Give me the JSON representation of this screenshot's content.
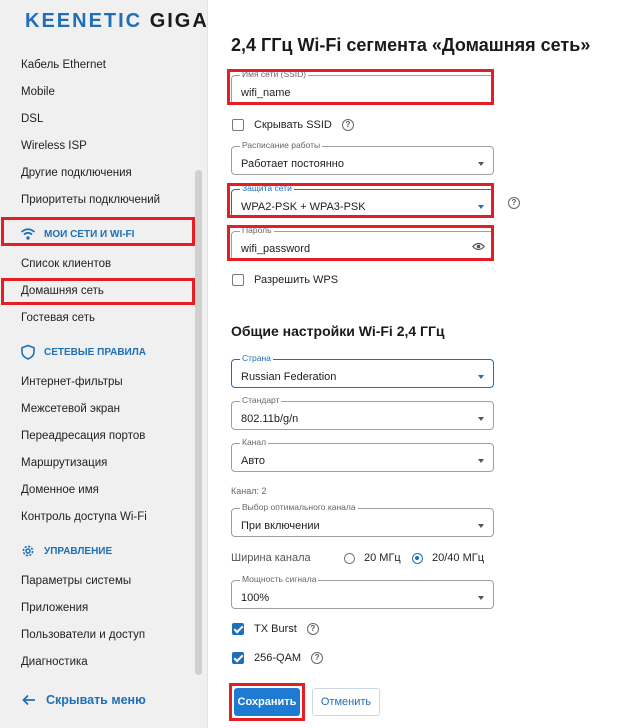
{
  "logo": {
    "text_main": "KEENETIC",
    "text_model": "GIGA"
  },
  "sidebar": {
    "items_top": [
      {
        "label": "Кабель Ethernet"
      },
      {
        "label": "Mobile"
      },
      {
        "label": "DSL"
      },
      {
        "label": "Wireless ISP"
      },
      {
        "label": "Другие подключения"
      },
      {
        "label": "Приоритеты подключений"
      }
    ],
    "section_wifi": {
      "label": "МОИ СЕТИ И WI-FI",
      "icon": "wifi-icon"
    },
    "items_wifi": [
      {
        "label": "Список клиентов"
      },
      {
        "label": "Домашняя сеть"
      },
      {
        "label": "Гостевая сеть"
      }
    ],
    "section_rules": {
      "label": "СЕТЕВЫЕ ПРАВИЛА",
      "icon": "shield-icon"
    },
    "items_rules": [
      {
        "label": "Интернет-фильтры"
      },
      {
        "label": "Межсетевой экран"
      },
      {
        "label": "Переадресация портов"
      },
      {
        "label": "Маршрутизация"
      },
      {
        "label": "Доменное имя"
      },
      {
        "label": "Контроль доступа Wi-Fi"
      }
    ],
    "section_manage": {
      "label": "УПРАВЛЕНИЕ",
      "icon": "gear-icon"
    },
    "items_manage": [
      {
        "label": "Параметры системы"
      },
      {
        "label": "Приложения"
      },
      {
        "label": "Пользователи и доступ"
      },
      {
        "label": "Диагностика"
      }
    ],
    "collapse_label": "Скрывать меню"
  },
  "main": {
    "title": "2,4 ГГц Wi-Fi сегмента «Домашняя сеть»",
    "ssid": {
      "label": "Имя сети (SSID)",
      "value": "wifi_name"
    },
    "hide_ssid": {
      "label": "Скрывать SSID",
      "checked": false
    },
    "schedule": {
      "label": "Расписание работы",
      "value": "Работает постоянно"
    },
    "security": {
      "label": "Защита сети",
      "value": "WPA2-PSK + WPA3-PSK"
    },
    "password": {
      "label": "Пароль",
      "value": "wifi_password"
    },
    "wps": {
      "label": "Разрешить WPS",
      "checked": false
    },
    "section_title": "Общие настройки Wi-Fi 2,4 ГГц",
    "country": {
      "label": "Страна",
      "value": "Russian Federation"
    },
    "standard": {
      "label": "Стандарт",
      "value": "802.11b/g/n"
    },
    "channel": {
      "label": "Канал",
      "value": "Авто"
    },
    "channel_info": "Канал: 2",
    "optimal_channel": {
      "label": "Выбор оптимального канала",
      "value": "При включении"
    },
    "channel_width": {
      "label": "Ширина канала",
      "options": [
        {
          "label": "20 МГц",
          "selected": false
        },
        {
          "label": "20/40 МГц",
          "selected": true
        }
      ]
    },
    "power": {
      "label": "Мощность сигнала",
      "value": "100%"
    },
    "tx_burst": {
      "label": "TX Burst",
      "checked": true
    },
    "qam": {
      "label": "256-QAM",
      "checked": true
    },
    "save_label": "Сохранить",
    "cancel_label": "Отменить"
  },
  "colors": {
    "accent": "#1f6fb8",
    "highlight": "#e31e24",
    "sidebar_bg": "#f0f0f0"
  }
}
